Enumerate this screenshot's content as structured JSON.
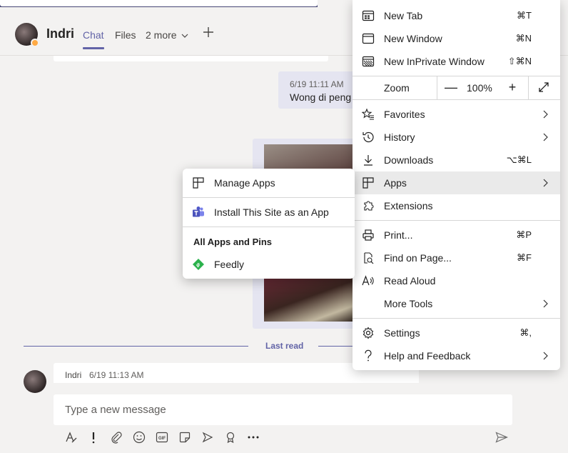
{
  "header": {
    "user_name": "Indri",
    "tabs": [
      {
        "label": "Chat"
      },
      {
        "label": "Files"
      },
      {
        "label": "2 more"
      }
    ],
    "add_tab_icon": "plus-icon"
  },
  "chat": {
    "messages": [
      {
        "time": "6/19 11:11 AM",
        "text": "Wong di peng"
      },
      {
        "author": "Indri",
        "time": "6/19 11:13 AM"
      }
    ],
    "last_read_label": "Last read"
  },
  "compose": {
    "placeholder": "Type a new message"
  },
  "edge_menu": {
    "new_tab": {
      "label": "New Tab",
      "shortcut": "⌘T"
    },
    "new_window": {
      "label": "New Window",
      "shortcut": "⌘N"
    },
    "new_inprivate": {
      "label": "New InPrivate Window",
      "shortcut": "⇧⌘N"
    },
    "zoom": {
      "label": "Zoom",
      "minus": "—",
      "value": "100%",
      "plus": "+"
    },
    "favorites": {
      "label": "Favorites"
    },
    "history": {
      "label": "History"
    },
    "downloads": {
      "label": "Downloads",
      "shortcut": "⌥⌘L"
    },
    "apps": {
      "label": "Apps"
    },
    "extensions": {
      "label": "Extensions"
    },
    "print": {
      "label": "Print...",
      "shortcut": "⌘P"
    },
    "find": {
      "label": "Find on Page...",
      "shortcut": "⌘F"
    },
    "read_aloud": {
      "label": "Read Aloud"
    },
    "more_tools": {
      "label": "More Tools"
    },
    "settings": {
      "label": "Settings",
      "shortcut": "⌘,"
    },
    "help": {
      "label": "Help and Feedback"
    }
  },
  "apps_menu": {
    "manage": "Manage Apps",
    "install": "Install This Site as an App",
    "heading": "All Apps and Pins",
    "pins": [
      {
        "label": "Feedly"
      }
    ]
  },
  "colors": {
    "teams_purple": "#6264a7",
    "menu_highlight": "#eaeaea",
    "feedly_green": "#2bb24c",
    "presence_away": "#ffaa44"
  }
}
